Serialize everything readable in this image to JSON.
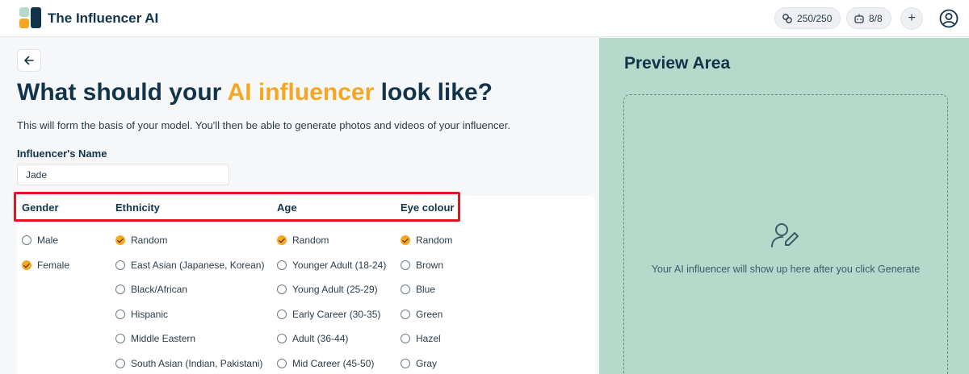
{
  "header": {
    "app_title": "The Influencer AI",
    "credits": "250/250",
    "models": "8/8",
    "add_symbol": "+"
  },
  "form": {
    "headline_pre": "What should your ",
    "headline_accent": "AI influencer",
    "headline_post": " look like?",
    "subtitle": "This will form the basis of your model. You'll then be able to generate photos and videos of your influencer.",
    "name_label": "Influencer's Name",
    "name_value": "Jade",
    "columns": {
      "gender": {
        "label": "Gender",
        "options": [
          {
            "label": "Male",
            "selected": false
          },
          {
            "label": "Female",
            "selected": true
          }
        ]
      },
      "ethnicity": {
        "label": "Ethnicity",
        "options": [
          {
            "label": "Random",
            "selected": true
          },
          {
            "label": "East Asian (Japanese, Korean)",
            "selected": false
          },
          {
            "label": "Black/African",
            "selected": false
          },
          {
            "label": "Hispanic",
            "selected": false
          },
          {
            "label": "Middle Eastern",
            "selected": false
          },
          {
            "label": "South Asian (Indian, Pakistani)",
            "selected": false
          }
        ]
      },
      "age": {
        "label": "Age",
        "options": [
          {
            "label": "Random",
            "selected": true
          },
          {
            "label": "Younger Adult (18-24)",
            "selected": false
          },
          {
            "label": "Young Adult (25-29)",
            "selected": false
          },
          {
            "label": "Early Career (30-35)",
            "selected": false
          },
          {
            "label": "Adult (36-44)",
            "selected": false
          },
          {
            "label": "Mid Career (45-50)",
            "selected": false
          }
        ]
      },
      "eye_colour": {
        "label": "Eye colour",
        "options": [
          {
            "label": "Random",
            "selected": true
          },
          {
            "label": "Brown",
            "selected": false
          },
          {
            "label": "Blue",
            "selected": false
          },
          {
            "label": "Green",
            "selected": false
          },
          {
            "label": "Hazel",
            "selected": false
          },
          {
            "label": "Gray",
            "selected": false
          }
        ]
      }
    }
  },
  "preview": {
    "title": "Preview Area",
    "empty_text": "Your AI influencer will show up here after you click Generate"
  },
  "colors": {
    "accent": "#f5a623",
    "navy": "#12344a",
    "preview_bg": "#b5d9cb",
    "highlight": "#e0171e"
  },
  "icons": [
    "logo-icon",
    "credits-icon",
    "robot-icon",
    "plus-icon",
    "user-circle-icon",
    "arrow-left-icon",
    "user-edit-icon",
    "check-icon"
  ]
}
